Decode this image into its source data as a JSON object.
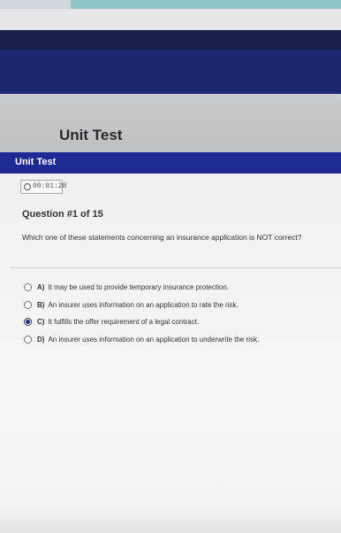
{
  "page": {
    "title": "Unit Test"
  },
  "title_bar": {
    "label": "Unit Test"
  },
  "timer": {
    "icon": "clock-icon",
    "value": "00:01:28"
  },
  "question": {
    "heading": "Question #1 of 15",
    "text": "Which one of these statements concerning an insurance application is NOT correct?",
    "options": [
      {
        "letter": "A)",
        "text": "It may be used to provide temporary insurance protection.",
        "selected": false
      },
      {
        "letter": "B)",
        "text": "An insurer uses information on an application to rate the risk.",
        "selected": false
      },
      {
        "letter": "C)",
        "text": "It fulfills the offer requirement of a legal contract.",
        "selected": true
      },
      {
        "letter": "D)",
        "text": "An insurer uses information on an application to underwrite the risk.",
        "selected": false
      }
    ]
  },
  "colors": {
    "nav_band": "#1d2670",
    "title_bar": "#1d2a93",
    "radio_selected": "#1f2a8f"
  }
}
